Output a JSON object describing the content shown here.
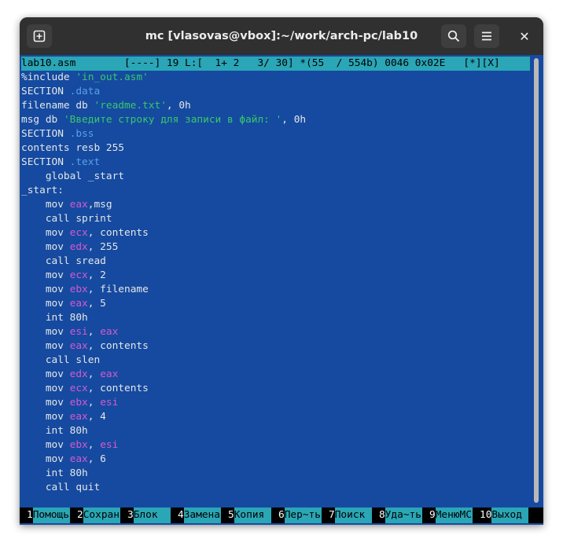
{
  "window": {
    "title": "mc [vlasovas@vbox]:~/work/arch-pc/lab10"
  },
  "titlebar": {
    "new_tab_icon": "plus-square-icon",
    "search_icon": "search-icon",
    "menu_icon": "hamburger-menu-icon",
    "close_icon": "close-icon",
    "close_glyph": "✕"
  },
  "editor": {
    "status": "lab10.asm        [----] 19 L:[  1+ 2   3/ 30] *(55  / 554b) 0046 0x02E   [*][X]",
    "lines": [
      [
        {
          "t": "%include ",
          "c": "kw"
        },
        {
          "t": "'in_out.asm'",
          "c": "str"
        }
      ],
      [
        {
          "t": "SECTION ",
          "c": "kw"
        },
        {
          "t": ".data",
          "c": "sec"
        }
      ],
      [
        {
          "t": "filename db ",
          "c": "kw"
        },
        {
          "t": "'readme.txt'",
          "c": "str"
        },
        {
          "t": ", 0h",
          "c": "kw"
        }
      ],
      [
        {
          "t": "msg db ",
          "c": "kw"
        },
        {
          "t": "'Введите строку для записи в файл: '",
          "c": "str"
        },
        {
          "t": ", 0h",
          "c": "kw"
        }
      ],
      [
        {
          "t": "SECTION ",
          "c": "kw"
        },
        {
          "t": ".bss",
          "c": "sec"
        }
      ],
      [
        {
          "t": "contents resb 255",
          "c": "kw"
        }
      ],
      [
        {
          "t": "SECTION ",
          "c": "kw"
        },
        {
          "t": ".text",
          "c": "sec"
        }
      ],
      [
        {
          "t": "    global _start",
          "c": "kw"
        }
      ],
      [
        {
          "t": "_start:",
          "c": "kw"
        }
      ],
      [
        {
          "t": "    mov ",
          "c": "kw"
        },
        {
          "t": "eax",
          "c": "reg"
        },
        {
          "t": ",msg",
          "c": "kw"
        }
      ],
      [
        {
          "t": "    call sprint",
          "c": "kw"
        }
      ],
      [
        {
          "t": "    mov ",
          "c": "kw"
        },
        {
          "t": "ecx",
          "c": "reg"
        },
        {
          "t": ", contents",
          "c": "kw"
        }
      ],
      [
        {
          "t": "    mov ",
          "c": "kw"
        },
        {
          "t": "edx",
          "c": "reg"
        },
        {
          "t": ", 255",
          "c": "kw"
        }
      ],
      [
        {
          "t": "    call sread",
          "c": "kw"
        }
      ],
      [
        {
          "t": "    mov ",
          "c": "kw"
        },
        {
          "t": "ecx",
          "c": "reg"
        },
        {
          "t": ", 2",
          "c": "kw"
        }
      ],
      [
        {
          "t": "    mov ",
          "c": "kw"
        },
        {
          "t": "ebx",
          "c": "reg"
        },
        {
          "t": ", filename",
          "c": "kw"
        }
      ],
      [
        {
          "t": "    mov ",
          "c": "kw"
        },
        {
          "t": "eax",
          "c": "reg"
        },
        {
          "t": ", 5",
          "c": "kw"
        }
      ],
      [
        {
          "t": "    int 80h",
          "c": "kw"
        }
      ],
      [
        {
          "t": "    mov ",
          "c": "kw"
        },
        {
          "t": "esi",
          "c": "reg"
        },
        {
          "t": ", ",
          "c": "kw"
        },
        {
          "t": "eax",
          "c": "reg"
        }
      ],
      [
        {
          "t": "    mov ",
          "c": "kw"
        },
        {
          "t": "eax",
          "c": "reg"
        },
        {
          "t": ", contents",
          "c": "kw"
        }
      ],
      [
        {
          "t": "    call slen",
          "c": "kw"
        }
      ],
      [
        {
          "t": "    mov ",
          "c": "kw"
        },
        {
          "t": "edx",
          "c": "reg"
        },
        {
          "t": ", ",
          "c": "kw"
        },
        {
          "t": "eax",
          "c": "reg"
        }
      ],
      [
        {
          "t": "    mov ",
          "c": "kw"
        },
        {
          "t": "ecx",
          "c": "reg"
        },
        {
          "t": ", contents",
          "c": "kw"
        }
      ],
      [
        {
          "t": "    mov ",
          "c": "kw"
        },
        {
          "t": "ebx",
          "c": "reg"
        },
        {
          "t": ", ",
          "c": "kw"
        },
        {
          "t": "esi",
          "c": "reg"
        }
      ],
      [
        {
          "t": "    mov ",
          "c": "kw"
        },
        {
          "t": "eax",
          "c": "reg"
        },
        {
          "t": ", 4",
          "c": "kw"
        }
      ],
      [
        {
          "t": "    int 80h",
          "c": "kw"
        }
      ],
      [
        {
          "t": "    mov ",
          "c": "kw"
        },
        {
          "t": "ebx",
          "c": "reg"
        },
        {
          "t": ", ",
          "c": "kw"
        },
        {
          "t": "esi",
          "c": "reg"
        }
      ],
      [
        {
          "t": "    mov ",
          "c": "kw"
        },
        {
          "t": "eax",
          "c": "reg"
        },
        {
          "t": ", 6",
          "c": "kw"
        }
      ],
      [
        {
          "t": "    int 80h",
          "c": "kw"
        }
      ],
      [
        {
          "t": "    call quit",
          "c": "kw"
        }
      ]
    ]
  },
  "fkeys": [
    {
      "n": "1",
      "label": "Помощь"
    },
    {
      "n": "2",
      "label": "Сохран"
    },
    {
      "n": "3",
      "label": "Блок  "
    },
    {
      "n": "4",
      "label": "Замена"
    },
    {
      "n": "5",
      "label": "Копия "
    },
    {
      "n": "6",
      "label": "Пер~ть"
    },
    {
      "n": "7",
      "label": "Поиск "
    },
    {
      "n": "8",
      "label": "Уда~ть"
    },
    {
      "n": "9",
      "label": "МенюMC"
    },
    {
      "n": "10",
      "label": "Выход "
    }
  ]
}
